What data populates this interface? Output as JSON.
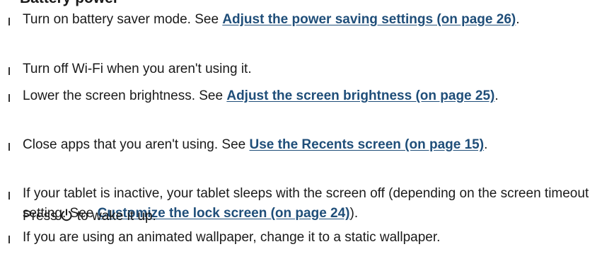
{
  "heading": "Battery power",
  "tips": [
    {
      "text": "Turn on battery saver mode. See ",
      "link": "Adjust the power saving settings (on page 26)",
      "after": "."
    },
    {
      "text": "Turn off Wi-Fi when you aren't using it."
    },
    {
      "text": "Lower the screen brightness. See ",
      "link": "Adjust the screen brightness (on page 25)",
      "after": "."
    },
    {
      "text": "Close apps that you aren't using. See ",
      "link": "Use the Recents screen (on page 15)",
      "after": "."
    },
    {
      "text": "If your tablet is inactive, your tablet sleeps with the screen off (depending on the screen timeout setting. See ",
      "link": "Customize the lock screen (on page 24)",
      "after": ").",
      "press_before": "Press",
      "press_after": "to wake it up.",
      "press_icon": "power-icon"
    },
    {
      "text": "If you are using an animated wallpaper, change it to a static wallpaper."
    }
  ]
}
